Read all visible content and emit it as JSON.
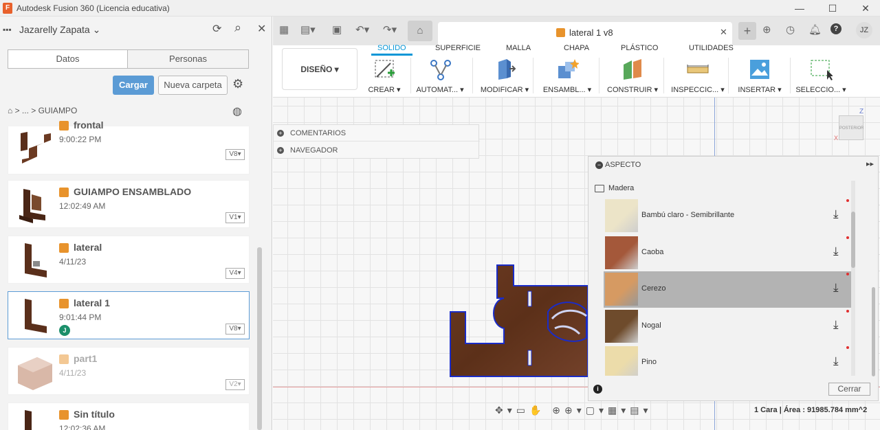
{
  "window": {
    "title": "Autodesk Fusion 360 (Licencia educativa)",
    "minimize": "—",
    "maximize": "☐",
    "close": "✕"
  },
  "left_panel": {
    "user": "Jazarelly Zapata",
    "user_chevron": "⌄",
    "refresh_icon": "⟳",
    "search_icon": "⌕",
    "close_icon": "✕",
    "tabs": [
      "Datos",
      "Personas"
    ],
    "upload_label": "Cargar",
    "new_folder_label": "Nueva carpeta",
    "breadcrumb": "⌂  >  ...  >  GUIAMPO",
    "items": [
      {
        "name": "frontal",
        "time": "9:00:22 PM",
        "version": "V8▾"
      },
      {
        "name": "GUIAMPO ENSAMBLADO",
        "time": "12:02:49 AM",
        "version": "V1▾"
      },
      {
        "name": "lateral",
        "time": "4/11/23",
        "version": "V4▾"
      },
      {
        "name": "lateral 1",
        "time": "9:01:44 PM",
        "version": "V8▾",
        "avatar": "J"
      },
      {
        "name": "part1",
        "time": "4/11/23",
        "version": "V2▾"
      },
      {
        "name": "Sin título",
        "time": "12:02:36 AM"
      }
    ]
  },
  "tab_bar": {
    "document_title": "lateral 1 v8",
    "document_close": "✕",
    "user_initials": "JZ"
  },
  "toolbar": {
    "workspace": "DISEÑO ▾",
    "tabs": [
      "SOLIDO",
      "SUPERFICIE",
      "MALLA",
      "CHAPA",
      "PLÁSTICO",
      "UTILIDADES"
    ],
    "tools": [
      "CREAR ▾",
      "AUTOMAT... ▾",
      "MODIFICAR ▾",
      "ENSAMBL... ▾",
      "CONSTRUIR ▾",
      "INSPECCIC... ▾",
      "INSERTAR ▾",
      "SELECCIO... ▾"
    ]
  },
  "browser_panels": [
    "COMENTARIOS",
    "NAVEGADOR"
  ],
  "viewcube": {
    "face": "POSTERIOR",
    "z": "Z",
    "x": "X"
  },
  "aspecto": {
    "title": "ASPECTO",
    "folder": "Madera",
    "materials": [
      {
        "name": "Bambú claro - Semibrillante",
        "color": "#ece4c8"
      },
      {
        "name": "Caoba",
        "color": "#a4583a"
      },
      {
        "name": "Cerezo",
        "color": "#d69a62",
        "selected": true
      },
      {
        "name": "Nogal",
        "color": "#6e4b2c"
      },
      {
        "name": "Pino",
        "color": "#ecdcaa"
      }
    ],
    "close_label": "Cerrar"
  },
  "status": "1 Cara | Área : 91985.784 mm^2",
  "colors": {
    "accent": "#0696d7",
    "upload_button": "#5b9bd5",
    "wood": "#6b3a22"
  }
}
